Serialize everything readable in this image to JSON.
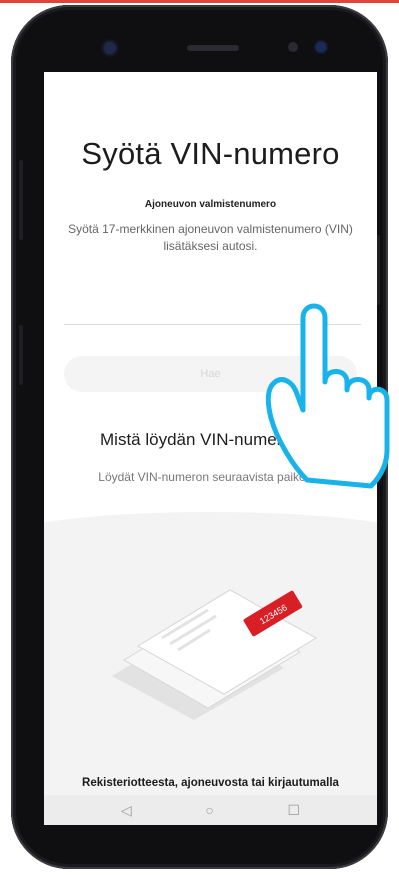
{
  "screen": {
    "title": "Syötä VIN-numero",
    "subtitle": "Ajoneuvon valmistenumero",
    "description": "Syötä 17-merkkinen ajoneuvon valmistenumero (VIN) lisätäksesi autosi.",
    "vin_input": {
      "value": "",
      "placeholder": ""
    },
    "search_label": "Hae",
    "help_title": "Mistä löydän VIN-numeron?",
    "help_text": "Löydät VIN-numeron seuraavista paikoista:",
    "card_number": "123456",
    "caption": "Rekisteriotteesta, ajoneuvosta tai kirjautumalla"
  },
  "navbar": {
    "back": "◁",
    "home": "○",
    "recents": "☐"
  },
  "colors": {
    "accent": "#e0453a",
    "card_red": "#d91f26",
    "hand_outline": "#18b4e9"
  },
  "icons": [
    "back-icon",
    "home-icon",
    "recents-icon",
    "tap-hand-icon"
  ]
}
